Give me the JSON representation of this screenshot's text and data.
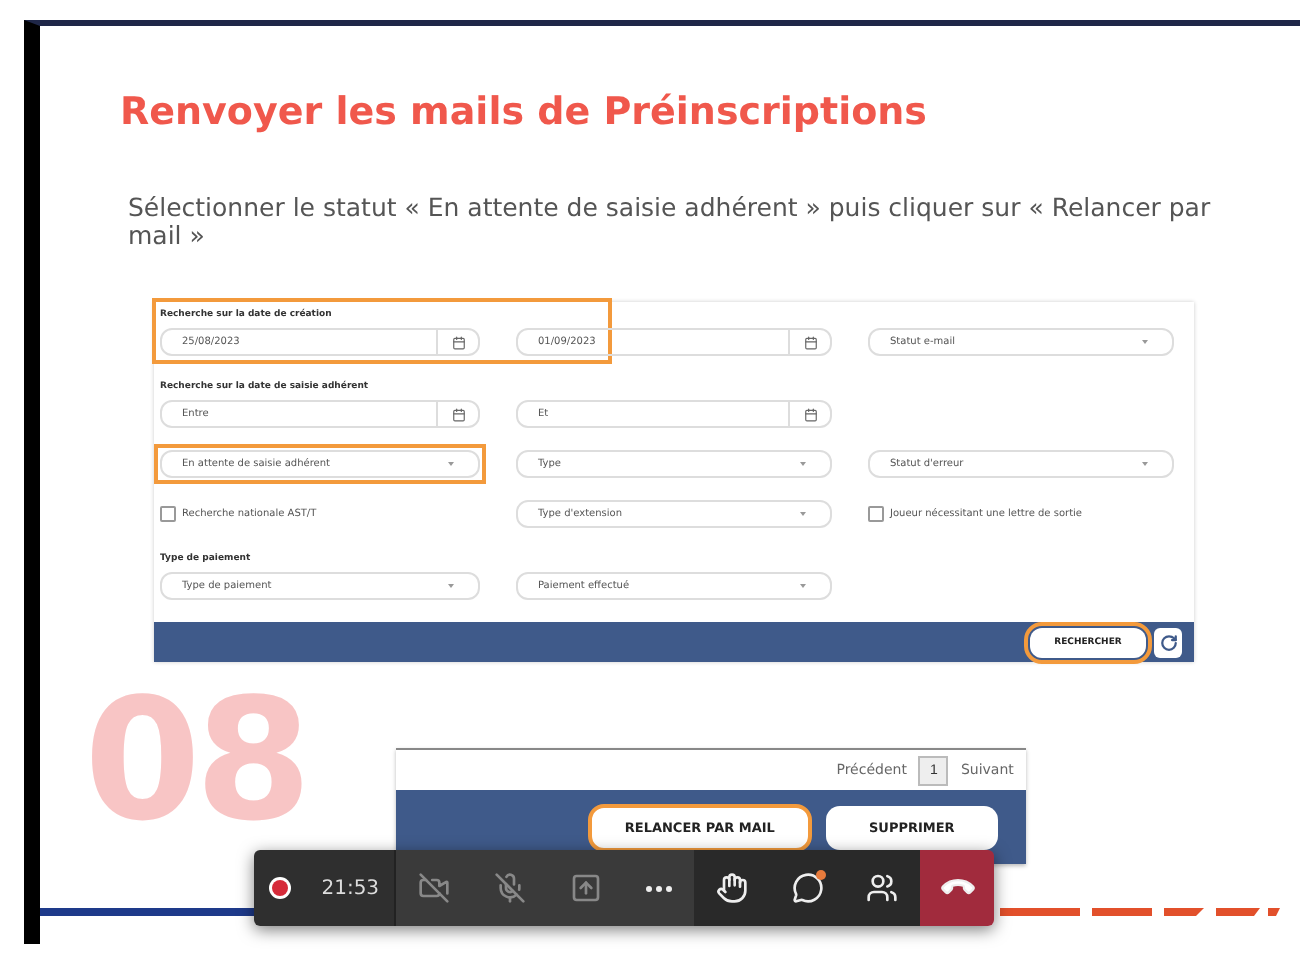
{
  "slide": {
    "title": "Renvoyer les mails de Préinscriptions",
    "instruction": "Sélectionner le statut « En attente de saisie adhérent » puis cliquer sur « Relancer par mail »",
    "number": "08"
  },
  "form": {
    "rows": [
      {
        "kind": "label",
        "text": "Recherche sur la date de création"
      },
      {
        "kind": "fields",
        "fields": [
          {
            "kind": "date",
            "value": "25/08/2023",
            "highlighted": true
          },
          {
            "kind": "date",
            "value": "01/09/2023",
            "highlighted": false
          },
          {
            "kind": "select",
            "placeholder": "Statut e-mail",
            "highlighted": false
          }
        ]
      },
      {
        "kind": "label",
        "text": "Recherche sur la date de saisie adhérent"
      },
      {
        "kind": "fields",
        "fields": [
          {
            "kind": "date",
            "placeholder": "Entre",
            "highlighted": false
          },
          {
            "kind": "date",
            "placeholder": "Et",
            "highlighted": false
          }
        ]
      },
      {
        "kind": "fields",
        "fields": [
          {
            "kind": "select",
            "value": "En attente de saisie adhérent",
            "highlighted": true
          },
          {
            "kind": "select",
            "placeholder": "Type",
            "highlighted": false
          },
          {
            "kind": "select",
            "placeholder": "Statut d'erreur",
            "highlighted": false
          }
        ]
      },
      {
        "kind": "fields",
        "fields": [
          {
            "kind": "checkbox",
            "text": "Recherche nationale AST/T",
            "checked": false,
            "highlighted": false
          },
          {
            "kind": "select",
            "placeholder": "Type d'extension",
            "highlighted": false
          },
          {
            "kind": "checkbox",
            "text": "Joueur nécessitant une lettre de sortie",
            "checked": false,
            "highlighted": false
          }
        ]
      },
      {
        "kind": "label",
        "text": "Type de paiement"
      },
      {
        "kind": "fields",
        "fields": [
          {
            "kind": "select",
            "placeholder": "Type de paiement",
            "highlighted": false
          },
          {
            "kind": "select",
            "placeholder": "Paiement effectué",
            "highlighted": false
          }
        ]
      }
    ],
    "search_button": {
      "label": "RECHERCHER",
      "highlighted": true
    }
  },
  "results": {
    "previous": "Précédent",
    "page": "1",
    "next": "Suivant",
    "buttons": [
      {
        "label": "RELANCER PAR MAIL",
        "highlighted": true
      },
      {
        "label": "SUPPRIMER",
        "highlighted": false
      }
    ]
  },
  "call_toolbar": {
    "recording": true,
    "time": "21:53",
    "chat_notification": true
  }
}
